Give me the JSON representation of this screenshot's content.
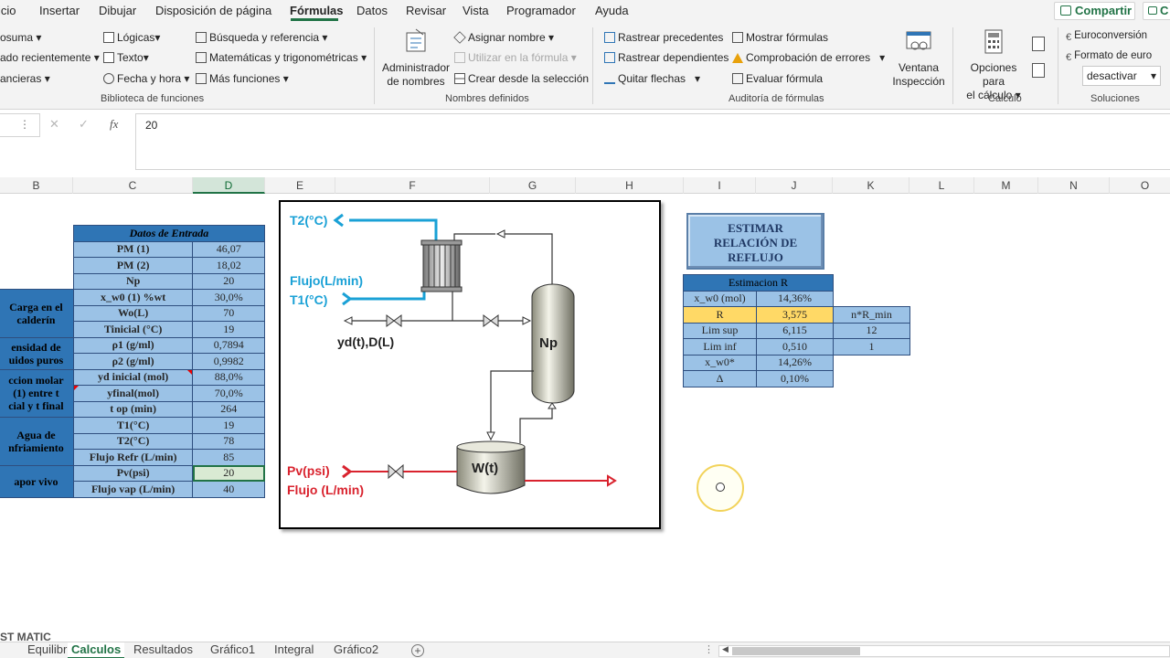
{
  "menu": {
    "items": [
      "icio",
      "Insertar",
      "Dibujar",
      "Disposición de página",
      "Fórmulas",
      "Datos",
      "Revisar",
      "Vista",
      "Programador",
      "Ayuda"
    ],
    "active": "Fórmulas",
    "share_label": "Compartir",
    "comment_label": "C"
  },
  "ribbon": {
    "lib": {
      "autosum": "osuma",
      "recent": "ado recientemente",
      "financial": "ancieras",
      "logical": "Lógicas",
      "text": "Texto",
      "datetime": "Fecha y hora",
      "lookup": "Búsqueda y referencia",
      "math": "Matemáticas y trigonométricas",
      "more": "Más funciones",
      "group_label": "Biblioteca de funciones"
    },
    "names": {
      "manager_l1": "Administrador",
      "manager_l2": "de nombres",
      "define": "Asignar nombre",
      "use": "Utilizar en la fórmula",
      "create": "Crear desde la selección",
      "group_label": "Nombres definidos"
    },
    "audit": {
      "precedents": "Rastrear precedentes",
      "dependents": "Rastrear dependientes",
      "remove": "Quitar flechas",
      "show": "Mostrar fórmulas",
      "errors": "Comprobación de errores",
      "evaluate": "Evaluar fórmula",
      "watch_l1": "Ventana",
      "watch_l2": "Inspección",
      "group_label": "Auditoría de fórmulas"
    },
    "calc": {
      "options_l1": "Opciones para",
      "options_l2": "el cálculo",
      "group_label": "Cálculo"
    },
    "solutions": {
      "euroconv": "Euroconversión",
      "euroformat": "Formato de euro",
      "dropdown": "desactivar",
      "group_label": "Soluciones"
    }
  },
  "formula_bar": {
    "fx": "fx",
    "value": "20"
  },
  "columns": [
    "B",
    "C",
    "D",
    "E",
    "F",
    "G",
    "H",
    "I",
    "J",
    "K",
    "L",
    "M",
    "N",
    "O"
  ],
  "selected_column": "D",
  "data_table": {
    "header": "Datos de Entrada",
    "rows": [
      {
        "group": "",
        "label": "PM (1)",
        "value": "46,07"
      },
      {
        "group": "",
        "label": "PM (2)",
        "value": "18,02"
      },
      {
        "group": "",
        "label": "Np",
        "value": "20"
      },
      {
        "group": "Carga en el",
        "label": "x_w0 (1) %wt",
        "value": "30,0%"
      },
      {
        "group": "calderín",
        "label": "Wo(L)",
        "value": "70"
      },
      {
        "group": "",
        "label": "Tinicial (°C)",
        "value": "19"
      },
      {
        "group": "ensidad de",
        "label": "ρ1 (g/ml)",
        "value": "0,7894"
      },
      {
        "group": "uidos puros",
        "label": "ρ2 (g/ml)",
        "value": "0,9982"
      },
      {
        "group": "ccion molar",
        "label": "yd inicial (mol)",
        "value": "88,0%"
      },
      {
        "group": "(1) entre t",
        "label": "yfinal(mol)",
        "value": "70,0%"
      },
      {
        "group": "cial y t final",
        "label": "t op (min)",
        "value": "264"
      },
      {
        "group": "Agua de",
        "label": "T1(°C)",
        "value": "19"
      },
      {
        "group": "",
        "label": "T2(°C)",
        "value": "78"
      },
      {
        "group": "nfriamiento",
        "label": "Flujo Refr (L/min)",
        "value": "85"
      },
      {
        "group": "apor vivo",
        "label": "Pv(psi)",
        "value": "20"
      },
      {
        "group": "",
        "label": "Flujo vap (L/min)",
        "value": "40"
      }
    ]
  },
  "diagram": {
    "t2": "T2(°C)",
    "flujo_top": "Flujo(L/min)",
    "t1": "T1(°C)",
    "yd": "yd(t),D(L)",
    "np": "Np",
    "pv": "Pv(psi)",
    "flujo_bottom": "Flujo (L/min)",
    "wt": "W(t)"
  },
  "estimar_button": {
    "line1": "ESTIMAR",
    "line2": "RELACIÓN DE",
    "line3": "REFLUJO"
  },
  "estimation": {
    "header": "Estimacion R",
    "rows": [
      {
        "label": "x_w0  (mol)",
        "value": "14,36%",
        "extra_label": "",
        "extra_value": ""
      },
      {
        "label": "R",
        "value": "3,575",
        "extra_label": "n*R_min",
        "extra_value": ""
      },
      {
        "label": "Lim sup",
        "value": "6,115",
        "extra_label": "",
        "extra_value": "12"
      },
      {
        "label": "Lim inf",
        "value": "0,510",
        "extra_label": "",
        "extra_value": "1"
      },
      {
        "label": "x_w0*",
        "value": "14,26%",
        "extra_label": "",
        "extra_value": ""
      },
      {
        "label": "Δ",
        "value": "0,10%",
        "extra_label": "",
        "extra_value": ""
      }
    ]
  },
  "sheet_tabs": {
    "tabs": [
      "Equilibrio",
      "Calculos",
      "Resultados",
      "Gráfico1",
      "Integral",
      "Gráfico2"
    ],
    "active": "Calculos"
  },
  "watermark": "ST MATIC",
  "colors": {
    "accent": "#217346",
    "cell_blue": "#9bc2e6",
    "header_blue": "#2f75b5",
    "highlight": "#ffd966",
    "stream_blue": "#1aa1d6",
    "stream_red": "#d9232e"
  }
}
